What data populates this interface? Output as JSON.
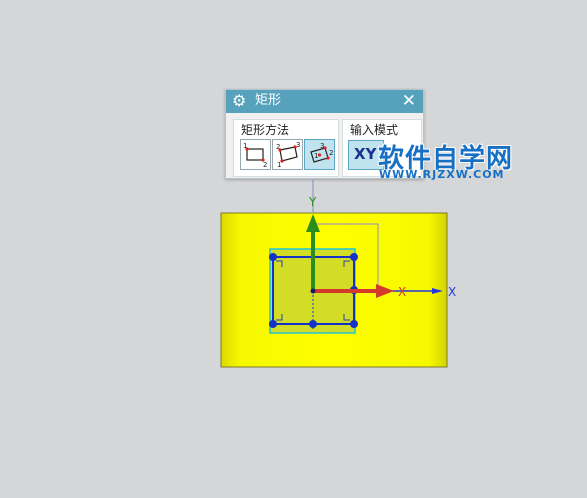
{
  "dialog": {
    "title": "矩形",
    "settings_icon": "gear-icon",
    "close_icon": "close-icon",
    "close_glyph": "✕",
    "method_group": {
      "label": "矩形方法",
      "buttons": [
        {
          "name": "two-point-rectangle",
          "icon": "two-point-rect-icon",
          "active": false,
          "labels": [
            "1",
            "2"
          ]
        },
        {
          "name": "three-point-rectangle",
          "icon": "three-point-rect-icon",
          "active": false,
          "labels": [
            "2",
            "3",
            "1"
          ]
        },
        {
          "name": "center-rectangle",
          "icon": "center-rect-icon",
          "active": true,
          "labels": [
            "3",
            "2",
            "1"
          ]
        }
      ]
    },
    "input_group": {
      "label": "输入模式",
      "xy_button": "XY"
    }
  },
  "watermark": {
    "main": "软件自学网",
    "sub": "WWW.RJZXW.COM"
  },
  "viewport": {
    "axis_x_label": "X",
    "axis_x_label_2": "X",
    "axis_y_label": "Y",
    "colors": {
      "background": "#d5d6d8",
      "plane": "#f5f500",
      "rectangle": "#1532c8",
      "axis_x": "#d33a2c",
      "axis_y": "#2c8e1a",
      "axis_view": "#2337e0"
    }
  }
}
